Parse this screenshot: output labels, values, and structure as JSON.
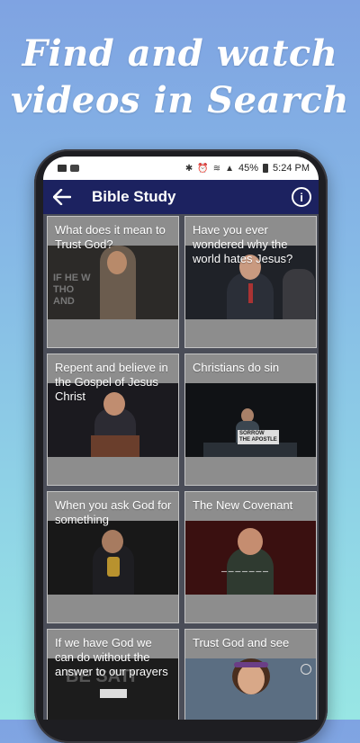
{
  "headline": {
    "line1": "Find and watch",
    "line2": "videos in Search"
  },
  "status_bar": {
    "battery": "45%",
    "time": "5:24 PM"
  },
  "app_bar": {
    "title": "Bible Study",
    "back_icon": "arrow-left-icon",
    "info_icon": "info-icon"
  },
  "videos": [
    {
      "title": "What does it mean to Trust God?"
    },
    {
      "title": "Have you ever wondered why the world hates Jesus?"
    },
    {
      "title": "Repent and believe in the Gospel of Jesus Christ"
    },
    {
      "title": "Christians do sin"
    },
    {
      "title": "When you ask God for something"
    },
    {
      "title": "The New Covenant"
    },
    {
      "title": "If we have God we can do without the answer to our prayers"
    },
    {
      "title": "Trust God and see"
    }
  ],
  "colors": {
    "app_bar": "#1c2260",
    "card": "#8d8d8d",
    "background_top": "#7fa3e2",
    "background_bottom": "#98e6e4"
  }
}
